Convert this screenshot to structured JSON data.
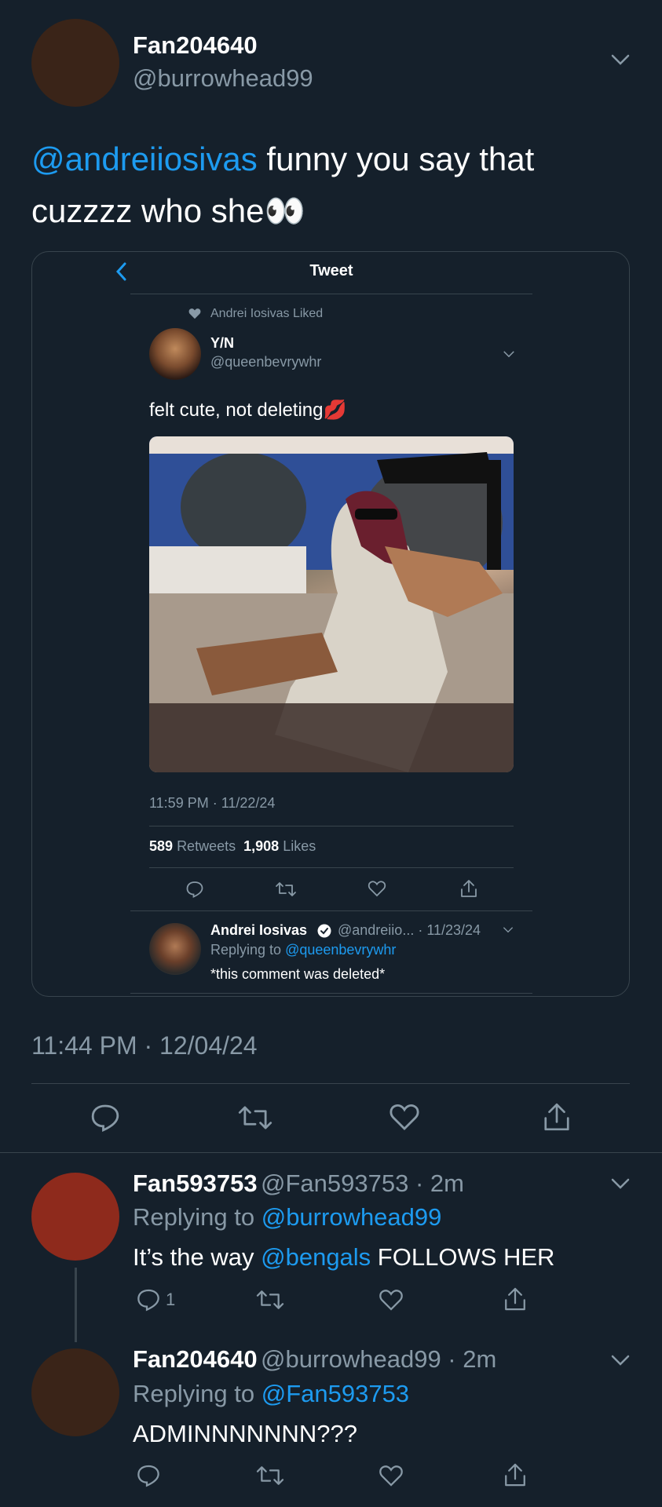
{
  "main_tweet": {
    "name": "Fan204640",
    "handle": "@burrowhead99",
    "mention": "@andreiiosivas",
    "text_line1": " funny you say that",
    "text_line2": "cuzzzz who she👀",
    "timestamp": "11:44 PM · 12/04/24",
    "avatar_color": "#3a2418"
  },
  "quoted_screenshot": {
    "header_title": "Tweet",
    "liked_by": "Andrei Iosivas Liked",
    "author_name": "Y/N",
    "author_handle": "@queenbevrywhr",
    "text": "felt cute, not deleting💋",
    "photo_alt": "selfie-photo",
    "timestamp": "11:59 PM · 11/22/24",
    "retweets_count": "589",
    "retweets_label": "Retweets",
    "likes_count": "1,908",
    "likes_label": "Likes",
    "reply": {
      "name": "Andrei Iosivas",
      "handle_time": "@andreiio... · 11/23/24",
      "replying_prefix": "Replying to ",
      "replying_handle": "@queenbevrywhr",
      "text": "*this comment was deleted*"
    }
  },
  "replies": [
    {
      "name": "Fan593753",
      "handle_time": "@Fan593753 · 2m",
      "replying_prefix": "Replying to ",
      "replying_handle": "@burrowhead99",
      "text_prefix": "It’s the way ",
      "text_mention": "@bengals",
      "text_suffix": " FOLLOWS HER",
      "reply_count": "1",
      "avatar_color": "#8e2a1c"
    },
    {
      "name": "Fan204640",
      "handle_time": "@burrowhead99 · 2m",
      "replying_prefix": "Replying to ",
      "replying_handle": "@Fan593753",
      "text": "ADMINNNNNNN???",
      "avatar_color": "#3a2418"
    }
  ],
  "icons": [
    "chevron-down-icon",
    "back-arrow-icon",
    "heart-icon",
    "verified-badge-icon",
    "reply-icon",
    "retweet-icon",
    "like-icon",
    "share-icon"
  ],
  "colors": {
    "background": "#15202b",
    "accent": "#1d9bf0",
    "secondary_text": "#8899a6",
    "divider": "#38444d"
  }
}
